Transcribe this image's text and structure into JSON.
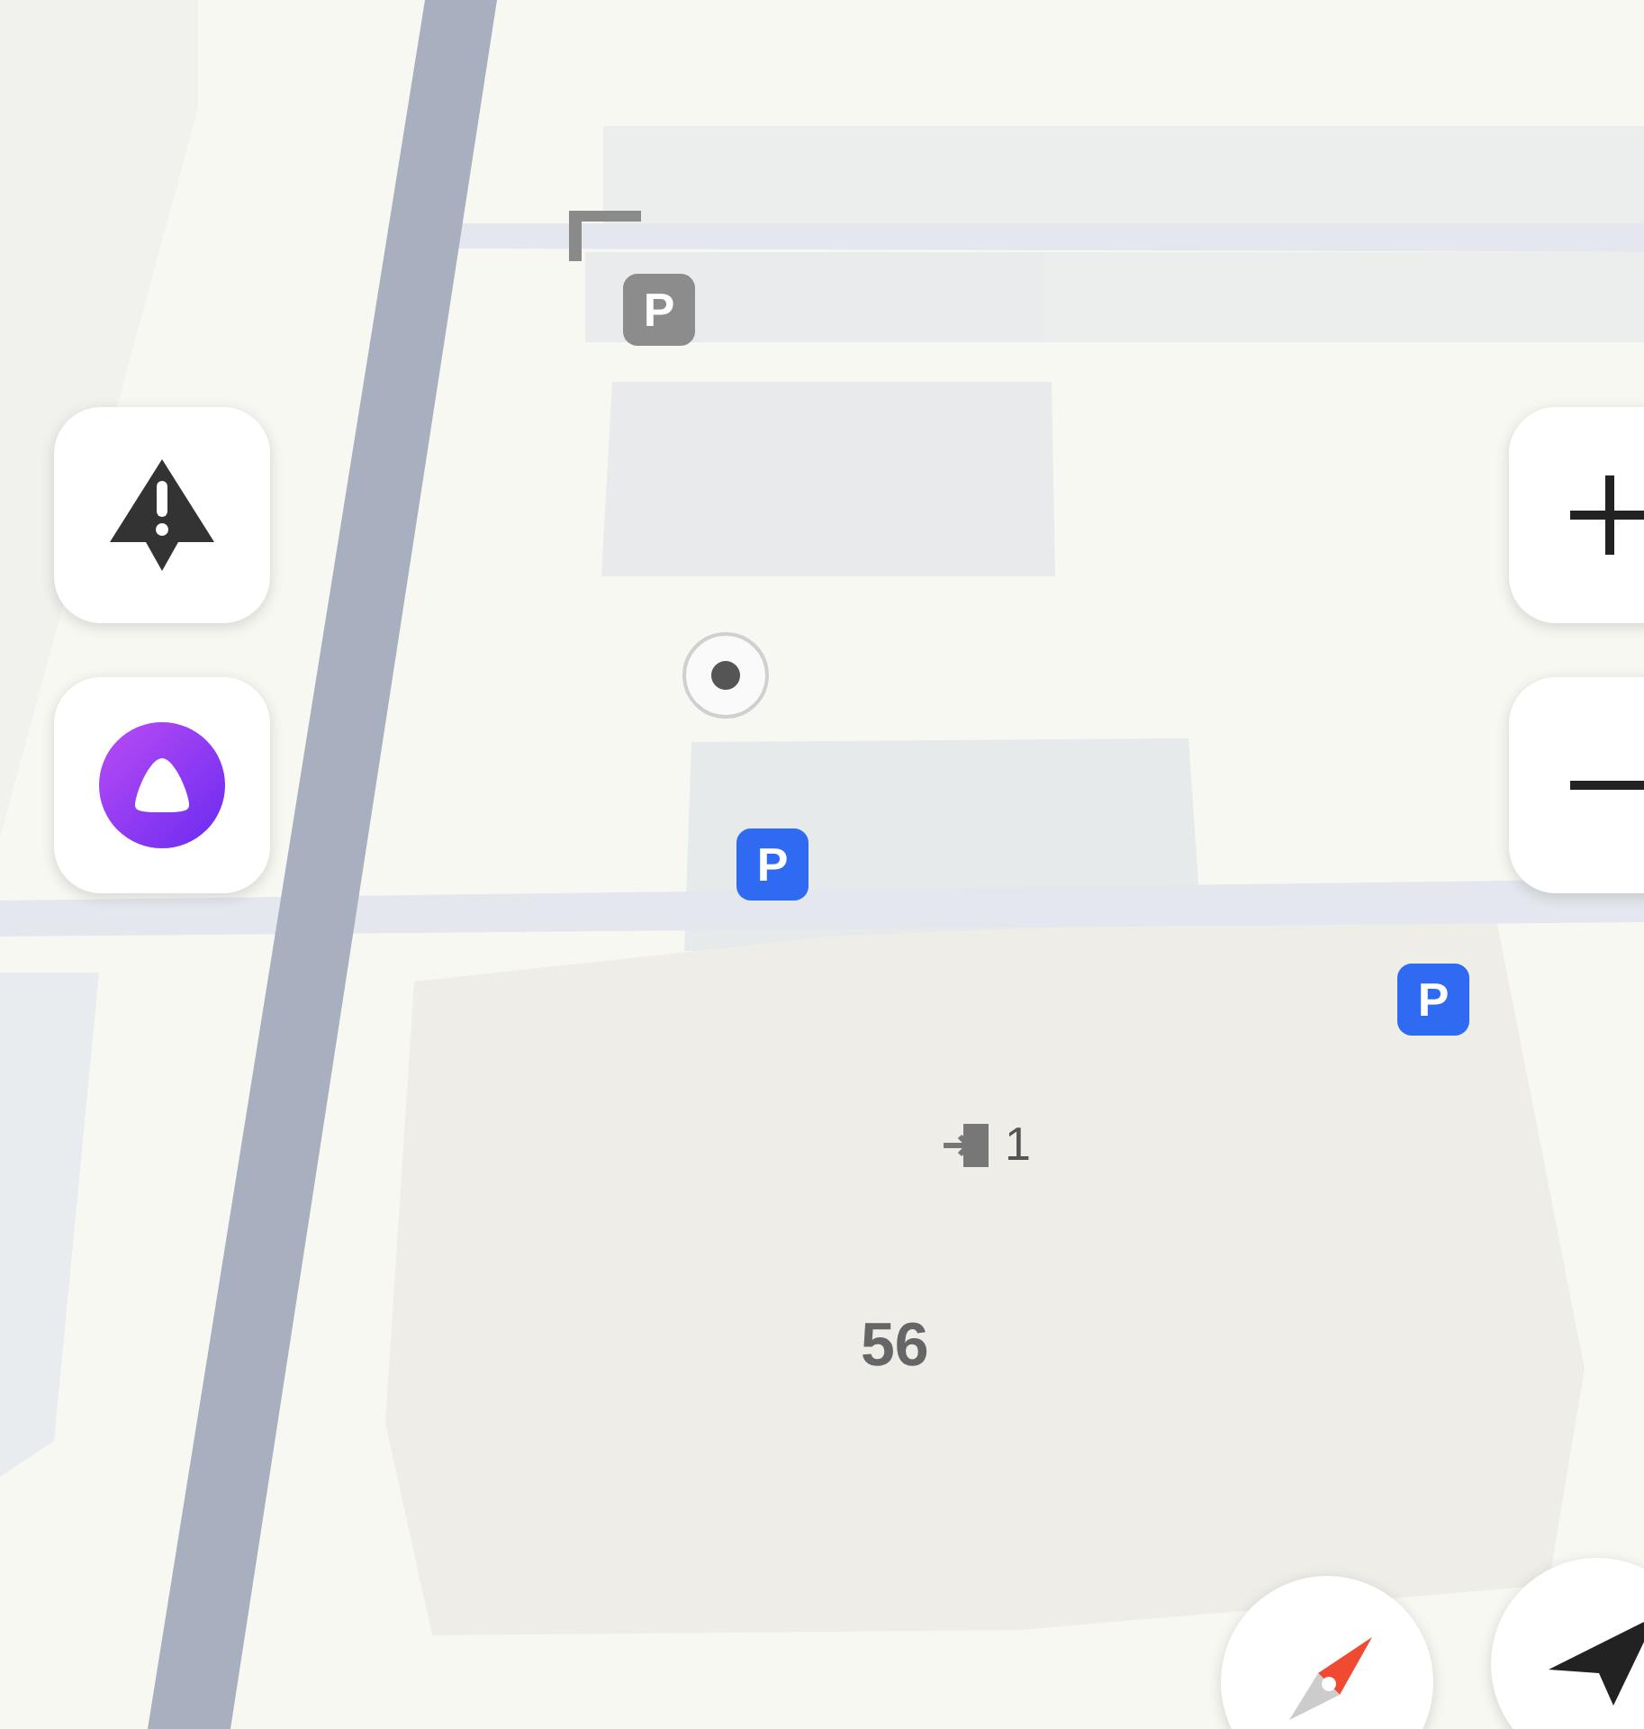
{
  "map": {
    "parking": [
      {
        "text": "P",
        "color": "#8c8c8c"
      },
      {
        "text": "P",
        "color": "#2f6bf2"
      },
      {
        "text": "P",
        "color": "#2f6bf2"
      }
    ],
    "entrance": {
      "text": "1"
    },
    "building_number": "56"
  },
  "controls": {
    "left": [
      {
        "kind": "alert"
      },
      {
        "kind": "assistant"
      }
    ],
    "right": [
      {
        "kind": "zoom_in"
      },
      {
        "kind": "zoom_out"
      }
    ],
    "bottom": [
      {
        "kind": "compass"
      },
      {
        "kind": "navigate"
      }
    ]
  }
}
